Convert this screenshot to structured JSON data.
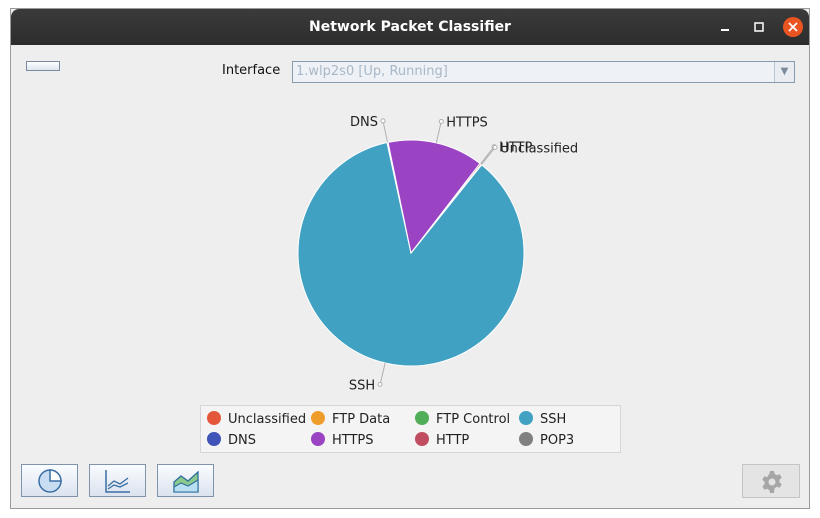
{
  "window": {
    "title": "Network Packet Classifier"
  },
  "toolbar": {
    "interface_label": "Interface",
    "interface_value": "1.wlp2s0 [Up, Running]"
  },
  "chart_data": {
    "type": "pie",
    "title": "",
    "slices": [
      {
        "label": "SSH",
        "value": 0.8585,
        "color": "#41a1c2"
      },
      {
        "label": "DNS",
        "value": 0.0015,
        "color": "#3f53b8"
      },
      {
        "label": "HTTPS",
        "value": 0.137,
        "color": "#9a44c4"
      },
      {
        "label": "HTTP",
        "value": 0.002,
        "color": "#c04d60"
      },
      {
        "label": "Unclassified",
        "value": 0.001,
        "color": "#e5573a"
      }
    ],
    "legend": {
      "position": "bottom",
      "items": [
        {
          "label": "Unclassified",
          "color": "#e5573a"
        },
        {
          "label": "FTP Data",
          "color": "#ef9d2a"
        },
        {
          "label": "FTP Control",
          "color": "#4fae57"
        },
        {
          "label": "SSH",
          "color": "#41a1c2"
        },
        {
          "label": "DNS",
          "color": "#3f53b8"
        },
        {
          "label": "HTTPS",
          "color": "#9a44c4"
        },
        {
          "label": "HTTP",
          "color": "#c04d60"
        },
        {
          "label": "POP3",
          "color": "#808080"
        }
      ]
    }
  },
  "buttons": {
    "pie_view_icon": "pie-chart-icon",
    "line_view_icon": "line-chart-icon",
    "area_view_icon": "area-chart-icon",
    "settings_icon": "gear-icon"
  }
}
